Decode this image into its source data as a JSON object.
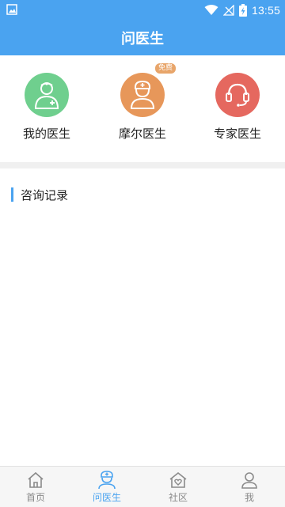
{
  "status_bar": {
    "time": "13:55",
    "left_icon": "image-icon",
    "icons": [
      "wifi-icon",
      "no-signal-icon",
      "battery-charging-icon"
    ]
  },
  "header": {
    "title": "问医生"
  },
  "shortcuts": [
    {
      "label": "我的医生",
      "icon": "doctor-icon",
      "color": "#6fcf8e",
      "badge": ""
    },
    {
      "label": "摩尔医生",
      "icon": "nurse-icon",
      "color": "#e7975a",
      "badge": "免费"
    },
    {
      "label": "专家医生",
      "icon": "headset-icon",
      "color": "#e5685f",
      "badge": ""
    }
  ],
  "section": {
    "title": "咨询记录"
  },
  "tabs": [
    {
      "label": "首页",
      "icon": "home-icon",
      "active": false
    },
    {
      "label": "问医生",
      "icon": "nurse-tab-icon",
      "active": true
    },
    {
      "label": "社区",
      "icon": "community-icon",
      "active": false
    },
    {
      "label": "我",
      "icon": "user-icon",
      "active": false
    }
  ],
  "colors": {
    "primary": "#4aa3f0",
    "tab_inactive": "#8a8a8a"
  }
}
